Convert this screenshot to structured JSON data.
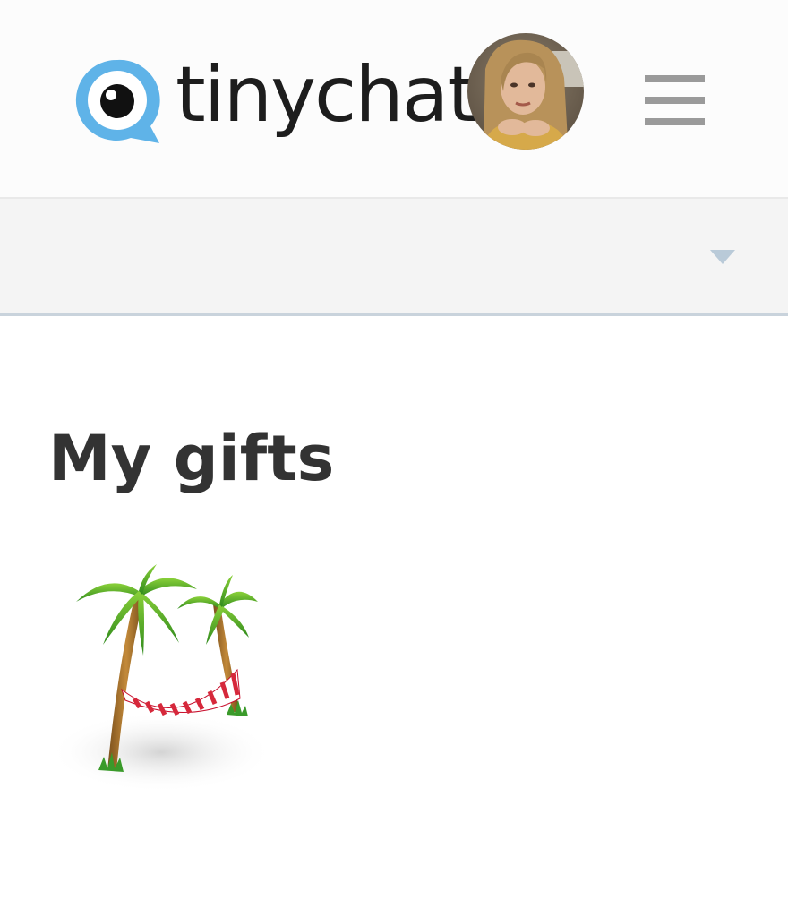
{
  "header": {
    "logo_text": "tinychat",
    "logo_icon": "tinychat-eye-bubble-icon",
    "avatar_icon": "user-avatar",
    "menu_icon": "hamburger-menu-icon"
  },
  "dropdown": {
    "selected_value": "",
    "chevron_icon": "chevron-down-icon"
  },
  "main": {
    "title": "My gifts",
    "gifts": [
      {
        "icon": "palm-trees-hammock-icon"
      }
    ]
  },
  "colors": {
    "brand_blue": "#5fb3e8",
    "text_dark": "#1d1d1d",
    "title_text": "#333333",
    "menu_gray": "#9a9a9a",
    "chevron": "#b9cad8",
    "dropdown_bg": "#f4f4f4"
  }
}
